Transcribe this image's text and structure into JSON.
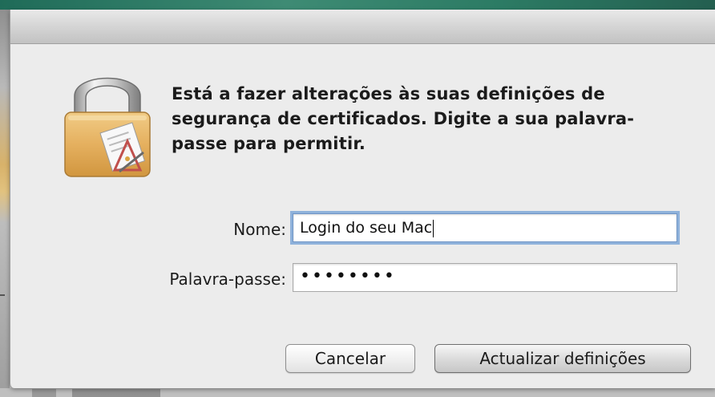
{
  "dialog": {
    "message": "Está a fazer alterações às suas definições de segurança de certificados. Digite a sua palavra-passe para permitir.",
    "lock_icon": "padlock-with-certificate-icon"
  },
  "form": {
    "name_label": "Nome:",
    "name_value": "Login do seu Mac",
    "password_label": "Palavra-passe:",
    "password_value": "••••••••"
  },
  "buttons": {
    "cancel_label": "Cancelar",
    "update_label": "Actualizar definições"
  },
  "colors": {
    "focus_ring": "#8fb2db",
    "lock_gold": "#e7b566"
  }
}
